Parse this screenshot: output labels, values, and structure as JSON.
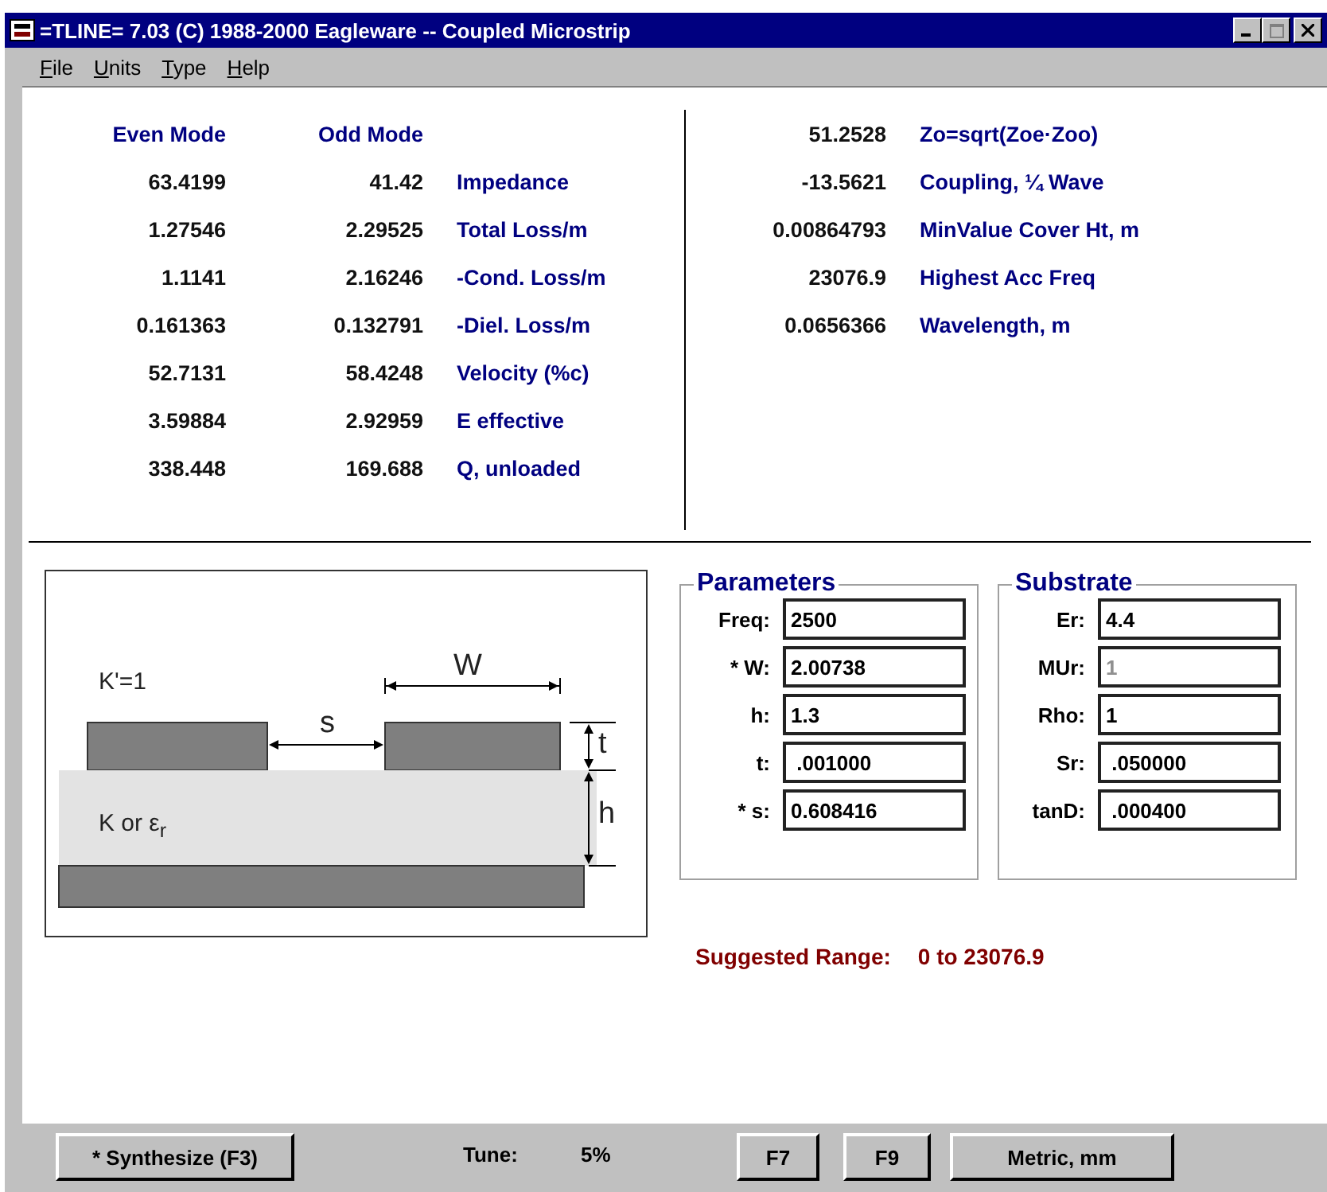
{
  "window": {
    "title": "=TLINE= 7.03 (C) 1988-2000 Eagleware -- Coupled Microstrip"
  },
  "menu": [
    "File",
    "Units",
    "Type",
    "Help"
  ],
  "mode_table": {
    "columns": [
      "Even Mode",
      "Odd Mode"
    ],
    "rows": [
      {
        "even": "63.4199",
        "odd": "41.42",
        "label": "Impedance"
      },
      {
        "even": "1.27546",
        "odd": "2.29525",
        "label": "Total Loss/m"
      },
      {
        "even": "1.1141",
        "odd": "2.16246",
        "label": "-Cond. Loss/m"
      },
      {
        "even": "0.161363",
        "odd": "0.132791",
        "label": "-Diel. Loss/m"
      },
      {
        "even": "52.7131",
        "odd": "58.4248",
        "label": "Velocity (%c)"
      },
      {
        "even": "3.59884",
        "odd": "2.92959",
        "label": "E effective"
      },
      {
        "even": "338.448",
        "odd": "169.688",
        "label": "Q, unloaded"
      }
    ]
  },
  "summary": [
    {
      "value": "51.2528",
      "label": "Zo=sqrt(Zoe·Zoo)"
    },
    {
      "value": "-13.5621",
      "label": "Coupling, ¼ Wave"
    },
    {
      "value": "0.00864793",
      "label": "MinValue Cover Ht, m"
    },
    {
      "value": "23076.9",
      "label": "Highest Acc Freq"
    },
    {
      "value": "0.0656366",
      "label": "Wavelength, m"
    }
  ],
  "diagram": {
    "air_label": "K'=1",
    "width_label": "W",
    "spacing_label": "s",
    "thickness_label": "t",
    "height_label": "h",
    "substrate_label": "K or ε$_{r}$"
  },
  "parameters": {
    "title": "Parameters",
    "fields": [
      {
        "label": "Freq:",
        "value": "2500",
        "disabled": false
      },
      {
        "label": "* W:",
        "value": "2.00738",
        "disabled": false
      },
      {
        "label": "h:",
        "value": "1.3",
        "disabled": false
      },
      {
        "label": "t:",
        "value": " .001000",
        "disabled": false
      },
      {
        "label": "* s:",
        "value": "0.608416",
        "disabled": false
      }
    ]
  },
  "substrate": {
    "title": "Substrate",
    "fields": [
      {
        "label": "Er:",
        "value": "4.4",
        "disabled": false
      },
      {
        "label": "MUr:",
        "value": "1",
        "disabled": true
      },
      {
        "label": "Rho:",
        "value": "1",
        "disabled": false
      },
      {
        "label": "Sr:",
        "value": " .050000",
        "disabled": false
      },
      {
        "label": "tanD:",
        "value": " .000400",
        "disabled": false
      }
    ]
  },
  "suggested_range": {
    "label": "Suggested Range:",
    "value": "0 to 23076.9"
  },
  "toolbar": {
    "synthesize": "* Synthesize (F3)",
    "tune_label": "Tune:",
    "tune_value": "5%",
    "buttons": [
      "F7",
      "F9",
      "Metric, mm"
    ]
  }
}
